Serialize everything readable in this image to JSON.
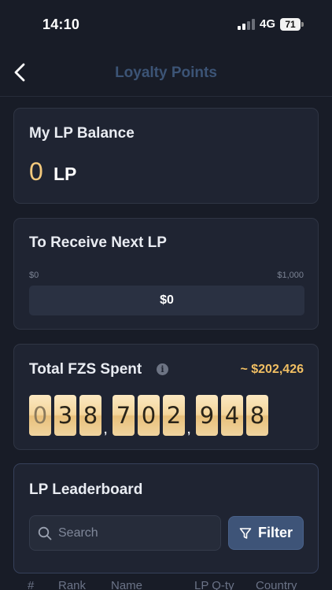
{
  "status_bar": {
    "time": "14:10",
    "network": "4G",
    "battery": "71"
  },
  "nav": {
    "title": "Loyalty Points",
    "back_icon": "chevron-left-icon"
  },
  "balance": {
    "title": "My LP Balance",
    "value": "0",
    "unit": "LP"
  },
  "next_lp": {
    "title": "To Receive Next LP",
    "range_min": "$0",
    "range_max": "$1,000",
    "current": "$0",
    "progress_fraction": 0
  },
  "spent": {
    "title": "Total FZS Spent",
    "info_icon": "info-icon",
    "usd_estimate": "~ $202,426",
    "digits": [
      "0",
      "3",
      "8",
      "7",
      "0",
      "2",
      "9",
      "4",
      "8"
    ],
    "separator": ","
  },
  "leaderboard": {
    "title": "LP Leaderboard",
    "search_placeholder": "Search",
    "filter_label": "Filter",
    "columns": [
      "#",
      "Rank",
      "Name",
      "LP Q-ty",
      "Country"
    ]
  },
  "colors": {
    "background": "#181c27",
    "card": "#1f2432",
    "accent_gold": "#f1bf63",
    "nav_title": "#3c5476",
    "filter_button": "#3e5478"
  }
}
